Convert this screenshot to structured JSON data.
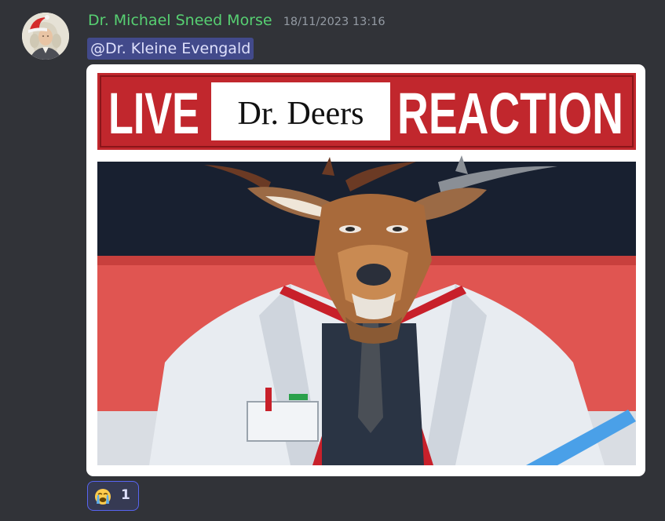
{
  "message": {
    "author": "Dr. Michael Sneed Morse",
    "timestamp": "18/11/2023 13:16",
    "mention": "@Dr. Kleine Evengald",
    "author_color": "#57d072",
    "mention_background": "#4b5290"
  },
  "avatar": {
    "icon": "santa-hat-portrait-avatar"
  },
  "attachment": {
    "banner_left": "LIVE",
    "banner_center": "Dr. Deers",
    "banner_right": "REACTION",
    "banner_color": "#c1272d",
    "illustration": "deer-doctor-in-lab-coat"
  },
  "reaction": {
    "emoji": "loudly-crying-face-icon",
    "count": "1",
    "border_color": "#5865f2"
  }
}
